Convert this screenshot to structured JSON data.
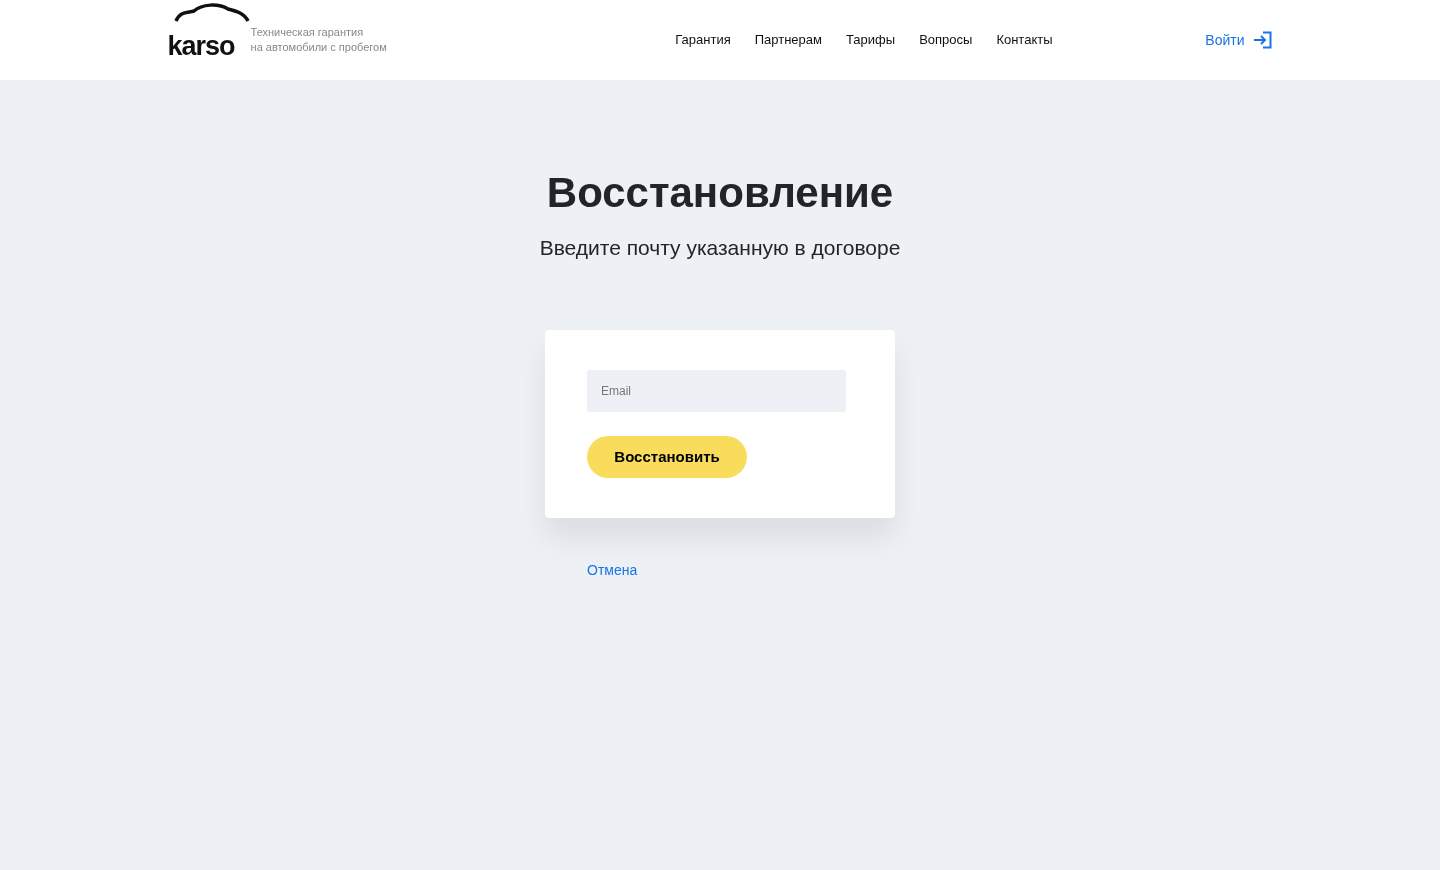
{
  "header": {
    "logo": "karso",
    "tagline": [
      "Техническая гарантия",
      "на автомобили с пробегом"
    ],
    "nav": [
      {
        "label": "Гарантия"
      },
      {
        "label": "Партнерам"
      },
      {
        "label": "Тарифы"
      },
      {
        "label": "Вопросы"
      },
      {
        "label": "Контакты"
      }
    ],
    "login": "Войти"
  },
  "title": "Восстановление",
  "subtitle": "Введите почту указанную в договоре",
  "form": {
    "email": {
      "placeholder": "Email"
    },
    "submit": "Восстановить"
  },
  "cancel": "Отмена"
}
